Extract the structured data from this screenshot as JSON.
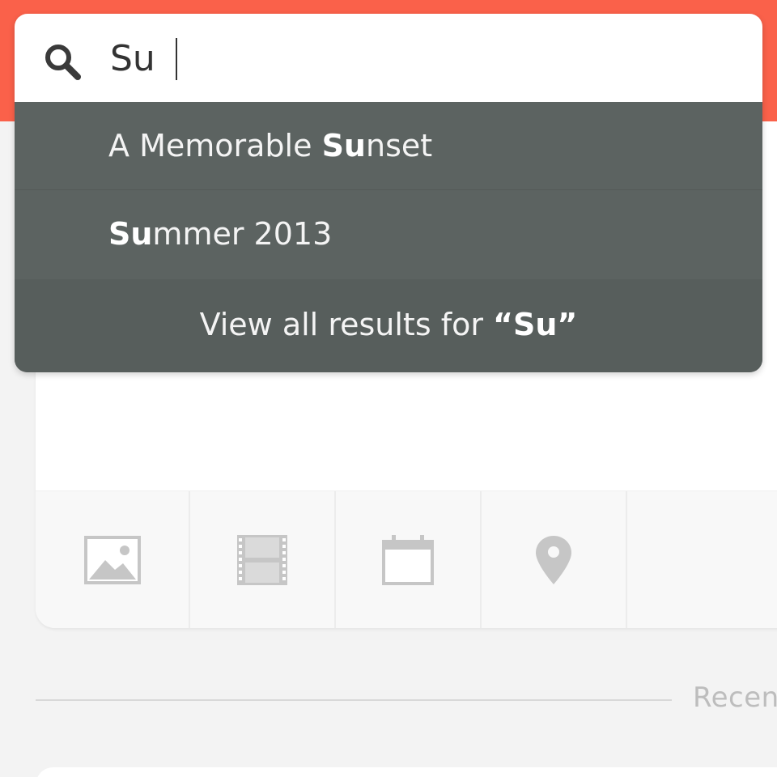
{
  "search": {
    "value": "Su",
    "icon": "search-icon"
  },
  "suggestions": [
    {
      "prefix": "A Memorable ",
      "match": "Su",
      "suffix": "nset"
    },
    {
      "prefix": "",
      "match": "Su",
      "suffix": "mmer 2013"
    }
  ],
  "view_all": {
    "label_prefix": "View all results for ",
    "query": "“Su”"
  },
  "toolbar": {
    "tools": [
      "image-icon",
      "video-icon",
      "calendar-icon",
      "location-pin-icon"
    ]
  },
  "section": {
    "label": "Recen"
  },
  "colors": {
    "header": "#fa614a",
    "dropdown": "#5c6361",
    "background": "#f3f3f3",
    "icon_gray": "#c6c6c6"
  }
}
